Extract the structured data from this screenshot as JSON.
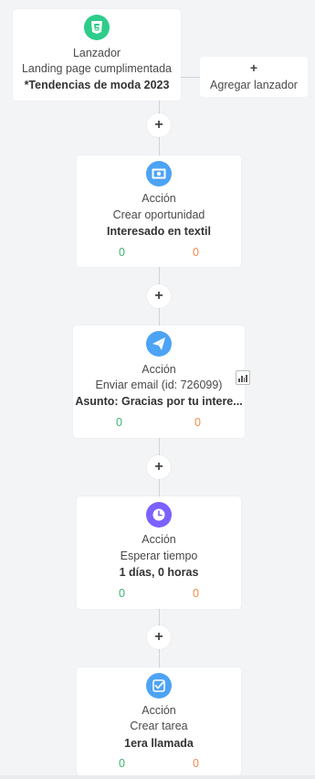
{
  "trigger": {
    "title": "Lanzador",
    "subtitle": "Landing page cumplimentada",
    "detail": "*Tendencias de moda 2023",
    "icon": "html5-icon",
    "icon_color": "#2ecc8a"
  },
  "add_trigger": {
    "plus": "+",
    "label": "Agregar lanzador"
  },
  "add_step": {
    "symbol": "+"
  },
  "steps": [
    {
      "type": "Acción",
      "name": "Crear oportunidad",
      "detail": "Interesado en textil",
      "count_success": "0",
      "count_fail": "0",
      "icon": "money-icon",
      "icon_color": "#4da3f5"
    },
    {
      "type": "Acción",
      "name": "Enviar email (id: 726099)",
      "detail": "Asunto: Gracias por tu intere...",
      "count_success": "0",
      "count_fail": "0",
      "icon": "send-icon",
      "icon_color": "#4da3f5"
    },
    {
      "type": "Acción",
      "name": "Esperar tiempo",
      "detail": "1 días, 0 horas",
      "count_success": "0",
      "count_fail": "0",
      "icon": "clock-icon",
      "icon_color": "#7b61ff"
    },
    {
      "type": "Acción",
      "name": "Crear tarea",
      "detail": "1era llamada",
      "count_success": "0",
      "count_fail": "0",
      "icon": "checkbox-icon",
      "icon_color": "#4da3f5"
    }
  ],
  "colors": {
    "success": "#3cb371",
    "fail": "#f08a4b",
    "background": "#f3f4f6"
  }
}
